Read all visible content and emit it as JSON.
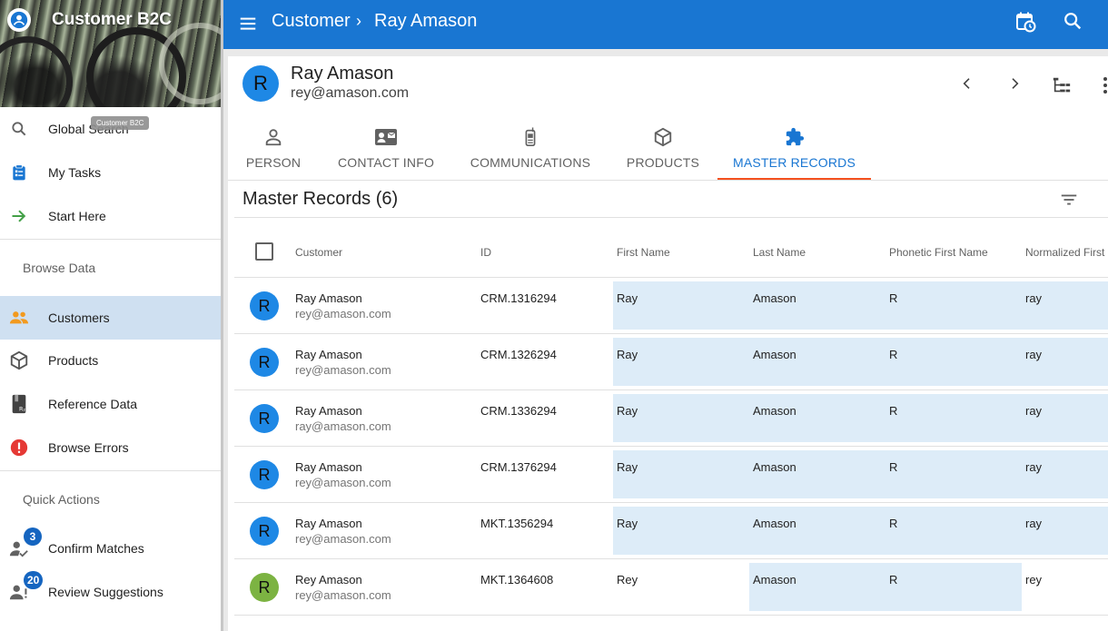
{
  "app": {
    "title": "Customer B2C",
    "tooltip": "Customer B2C"
  },
  "sidebar": {
    "items_top": [
      {
        "label": "Global Search",
        "icon": "search-icon"
      },
      {
        "label": "My Tasks",
        "icon": "clipboard-icon"
      },
      {
        "label": "Start Here",
        "icon": "arrow-right-icon"
      }
    ],
    "browse_section": "Browse Data",
    "items_browse": [
      {
        "label": "Customers",
        "icon": "people-icon",
        "active": true
      },
      {
        "label": "Products",
        "icon": "cube-icon"
      },
      {
        "label": "Reference Data",
        "icon": "reference-book-icon"
      },
      {
        "label": "Browse Errors",
        "icon": "error-icon"
      }
    ],
    "quick_section": "Quick Actions",
    "items_quick": [
      {
        "label": "Confirm Matches",
        "icon": "person-check-icon",
        "badge": "3"
      },
      {
        "label": "Review Suggestions",
        "icon": "person-alert-icon",
        "badge": "20"
      }
    ]
  },
  "topbar": {
    "breadcrumb_root": "Customer",
    "breadcrumb_current": "Ray Amason",
    "color": "#1976d2"
  },
  "record": {
    "initial": "R",
    "name": "Ray Amason",
    "email": "rey@amason.com"
  },
  "tabs": [
    {
      "label": "PERSON",
      "icon": "person-icon"
    },
    {
      "label": "CONTACT INFO",
      "icon": "contact-card-icon"
    },
    {
      "label": "COMMUNICATIONS",
      "icon": "phone-icon"
    },
    {
      "label": "PRODUCTS",
      "icon": "cube-icon"
    },
    {
      "label": "MASTER RECORDS",
      "icon": "puzzle-icon",
      "active": true
    }
  ],
  "master_records": {
    "title": "Master Records (6)",
    "columns": [
      "Customer",
      "ID",
      "First Name",
      "Last Name",
      "Phonetic First Name",
      "Normalized First"
    ],
    "rows": [
      {
        "initial": "R",
        "name": "Ray Amason",
        "email": "rey@amason.com",
        "id": "CRM.1316294",
        "first": "Ray",
        "last": "Amason",
        "phonetic": "R",
        "normalized": "ray",
        "avatar_color": "#1e88e5"
      },
      {
        "initial": "R",
        "name": "Ray Amason",
        "email": "rey@amason.com",
        "id": "CRM.1326294",
        "first": "Ray",
        "last": "Amason",
        "phonetic": "R",
        "normalized": "ray",
        "avatar_color": "#1e88e5"
      },
      {
        "initial": "R",
        "name": "Ray Amason",
        "email": "ray@amason.com",
        "id": "CRM.1336294",
        "first": "Ray",
        "last": "Amason",
        "phonetic": "R",
        "normalized": "ray",
        "avatar_color": "#1e88e5"
      },
      {
        "initial": "R",
        "name": "Ray Amason",
        "email": "rey@amason.com",
        "id": "CRM.1376294",
        "first": "Ray",
        "last": "Amason",
        "phonetic": "R",
        "normalized": "ray",
        "avatar_color": "#1e88e5"
      },
      {
        "initial": "R",
        "name": "Ray Amason",
        "email": "rey@amason.com",
        "id": "MKT.1356294",
        "first": "Ray",
        "last": "Amason",
        "phonetic": "R",
        "normalized": "ray",
        "avatar_color": "#1e88e5"
      },
      {
        "initial": "R",
        "name": "Rey Amason",
        "email": "rey@amason.com",
        "id": "MKT.1364608",
        "first": "Rey",
        "last": "Amason",
        "phonetic": "R",
        "normalized": "rey",
        "avatar_color": "#7cb342"
      }
    ]
  }
}
